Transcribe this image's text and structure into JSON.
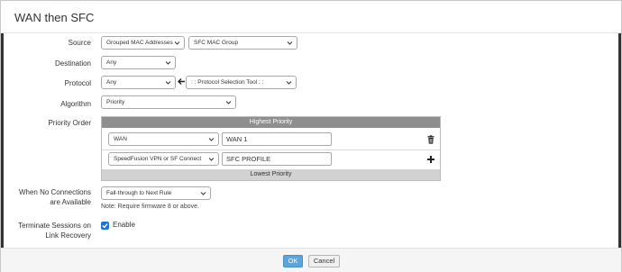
{
  "dialog": {
    "title": "WAN then SFC"
  },
  "form": {
    "source": {
      "label": "Source",
      "type_value": "Grouped MAC Addresses",
      "group_value": "SFC MAC Group"
    },
    "destination": {
      "label": "Destination",
      "value": "Any"
    },
    "protocol": {
      "label": "Protocol",
      "value": "Any",
      "tool_value": ": : Protocol Selection Tool : :"
    },
    "algorithm": {
      "label": "Algorithm",
      "value": "Priority"
    },
    "priority_order": {
      "label": "Priority Order",
      "highest_label": "Highest Priority",
      "lowest_label": "Lowest Priority",
      "rows": [
        {
          "connection": "WAN",
          "name": "WAN 1",
          "action_icon": "trash-icon"
        },
        {
          "connection": "SpeedFusion VPN or SF Connect",
          "name": "SFC PROFILE",
          "action_icon": "plus-icon"
        }
      ]
    },
    "no_connections": {
      "label_line1": "When No Connections",
      "label_line2": "are Available",
      "value": "Fall-through to Next Rule",
      "note": "Note: Require firmware 8 or above."
    },
    "terminate_sessions": {
      "label_line1": "Terminate Sessions on",
      "label_line2": "Link Recovery",
      "checked": true,
      "option_label": "Enable"
    }
  },
  "footer": {
    "ok_label": "OK",
    "cancel_label": "Cancel"
  },
  "colors": {
    "ok_button": "#5ba4dc",
    "checkbox": "#1f74d6",
    "highest_bar": "#8e8e8e",
    "lowest_bar": "#d2d2d2"
  }
}
